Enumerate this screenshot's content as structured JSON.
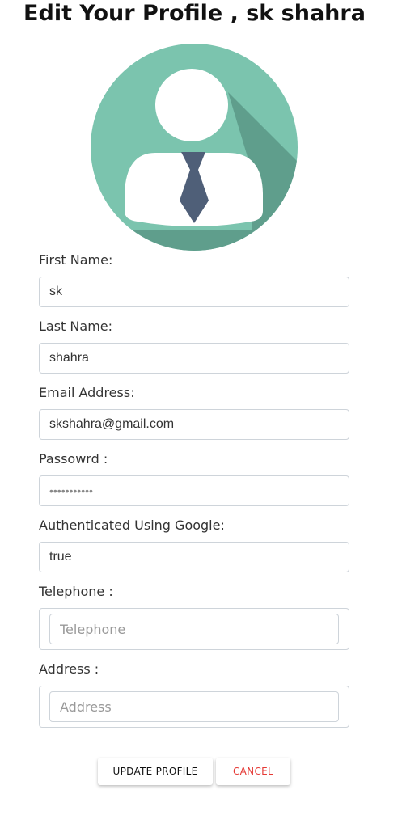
{
  "page": {
    "title": "Edit Your Profile , sk shahra"
  },
  "avatar": {
    "icon": "user-avatar-icon",
    "colors": {
      "circle": "#7bc4ae",
      "shadow": "#5f9e8c",
      "figure": "#ffffff",
      "tie": "#4f5f78"
    }
  },
  "form": {
    "first_name": {
      "label": "First Name:",
      "value": "sk"
    },
    "last_name": {
      "label": "Last Name:",
      "value": "shahra"
    },
    "email": {
      "label": "Email Address:",
      "value": "skshahra@gmail.com"
    },
    "password": {
      "label": "Passowrd :",
      "value": "•••••••••••"
    },
    "google_auth": {
      "label": "Authenticated Using Google:",
      "value": "true"
    },
    "telephone": {
      "label": "Telephone :",
      "placeholder": "Telephone"
    },
    "address": {
      "label": "Address :",
      "placeholder": "Address"
    }
  },
  "actions": {
    "update_label": "UPDATE PROFILE",
    "cancel_label": "CANCEL",
    "cancel_color": "#e53935"
  }
}
